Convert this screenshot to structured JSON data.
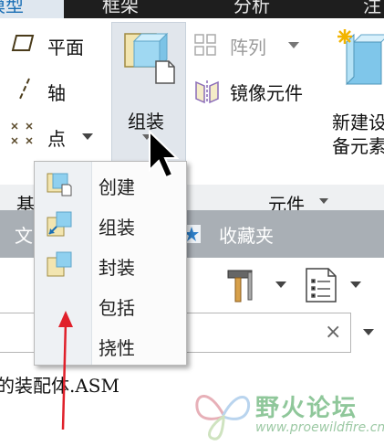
{
  "tabs": {
    "active": "模型",
    "t1": "框架",
    "t2": "分析",
    "t3": "注"
  },
  "ribbon": {
    "datum": {
      "plane": "平面",
      "axis": "轴",
      "point": "点",
      "group_label": "基"
    },
    "components": {
      "assemble": "组装",
      "pattern": "阵列",
      "mirror": "镜像元件",
      "new_line1": "新建设",
      "new_line2": "备元素",
      "group_label": "元件"
    }
  },
  "assemble_menu": {
    "items": [
      {
        "label": "创建"
      },
      {
        "label": "组装"
      },
      {
        "label": "封装"
      },
      {
        "label": "包括"
      },
      {
        "label": "挠性"
      }
    ]
  },
  "tree_bar": {
    "tab1": "文",
    "favorites": "收藏夹"
  },
  "search": {
    "clear": "×"
  },
  "document": {
    "name": "的装配体.ASM"
  },
  "watermark": {
    "title": "野火论坛",
    "url": "www.proewildfire.cn"
  }
}
